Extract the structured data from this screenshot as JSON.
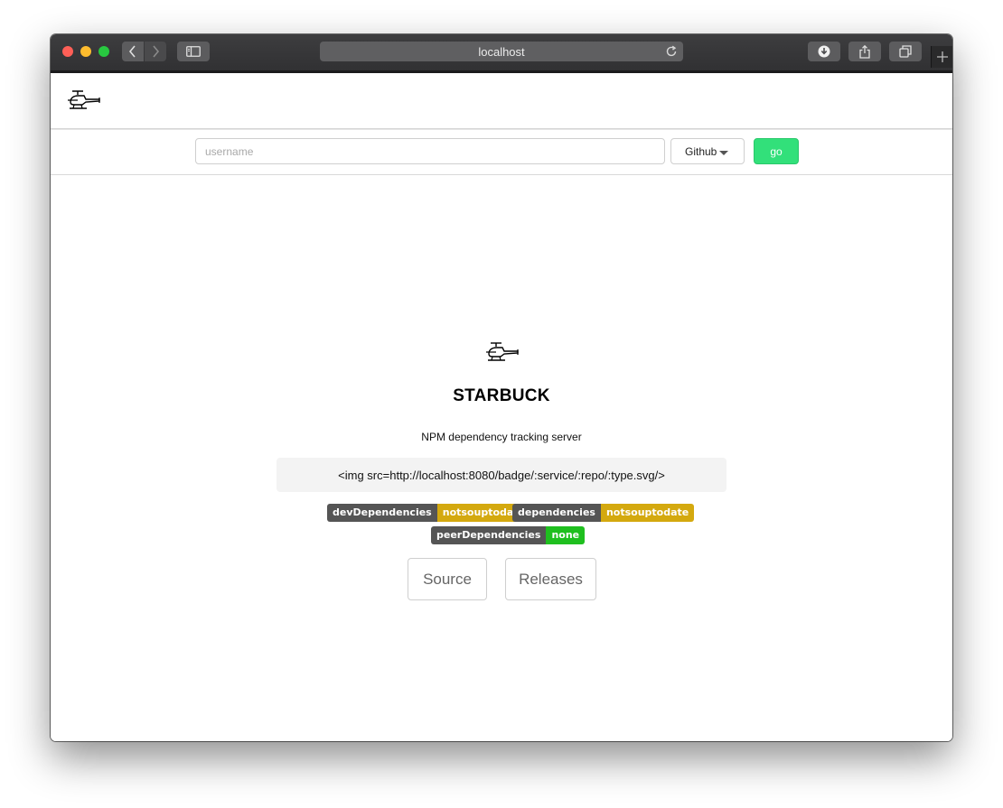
{
  "browser": {
    "url": "localhost",
    "new_tab_icon": "plus-icon"
  },
  "search": {
    "username_placeholder": "username",
    "username_value": "",
    "service_selected": "Github",
    "go_label": "go"
  },
  "hero": {
    "title": "STARBUCK",
    "subtitle": "NPM dependency tracking server",
    "badge_url": "<img src=http://localhost:8080/badge/:service/:repo/:type.svg/>"
  },
  "badges": [
    {
      "key": "devDependencies",
      "value": "notsouptodate",
      "color": "#d4a90f"
    },
    {
      "key": "dependencies",
      "value": "notsouptodate",
      "color": "#d4a90f"
    },
    {
      "key": "peerDependencies",
      "value": "none",
      "color": "#1fbf1f"
    }
  ],
  "links": {
    "source_label": "Source",
    "releases_label": "Releases"
  },
  "colors": {
    "go_button": "#32e07a",
    "badge_key_bg": "#555555"
  }
}
